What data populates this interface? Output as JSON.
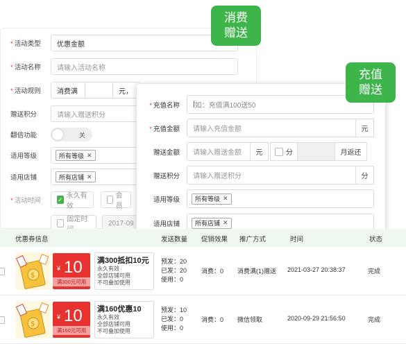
{
  "badges": {
    "consume": "消费\n赠送",
    "recharge": "充值\n赠送"
  },
  "back_form": {
    "type_label": "活动类型",
    "type_value": "优惠金额",
    "name_label": "活动名称",
    "name_placeholder": "请输入活动名称",
    "rule_label": "活动规则",
    "rule_prefix": "消费满",
    "rule_unit": "元，",
    "points_label": "赠送积分",
    "points_placeholder": "请输入赠送积分",
    "double_label": "翻倍功能",
    "double_state": "关",
    "level_label": "适用等级",
    "level_tag": "所有等级",
    "store_label": "适用店铺",
    "store_tag": "所有店铺",
    "time_label": "活动时间",
    "permanent_label": "永久有效",
    "member_label": "会员",
    "fixed_label": "固定时间",
    "fixed_date": "2017-09"
  },
  "front_form": {
    "name_label": "充值名称",
    "name_placeholder": "如：充值满100送50",
    "amount_label": "充值金额",
    "amount_placeholder": "请输入充值金额",
    "amount_unit": "元",
    "gift_label": "赠送金额",
    "gift_placeholder": "请输入赠送金额",
    "gift_unit": "元",
    "gift_fen": "分",
    "gift_monthly": "月返还",
    "points_label": "赠送积分",
    "points_placeholder": "请输入赠送积分",
    "points_unit": "分",
    "level_label": "适用等级",
    "level_tag": "所有等级",
    "store_label": "适用店铺",
    "store_tag": "所有店铺"
  },
  "table": {
    "headers": {
      "coupon": "优惠券信息",
      "sent": "发送数量",
      "effect": "促销效果",
      "method": "推广方式",
      "time": "时间",
      "status": "状态"
    },
    "rows": [
      {
        "coupon_amount": "10",
        "coupon_yen": "¥",
        "coupon_avail": "满300元可用",
        "name": "满300抵扣10元",
        "line1": "永久有效",
        "line2": "全部店铺可用",
        "line3": "不可叠加使用",
        "pre": "预发：20",
        "issued": "已发：20",
        "used": "使用：0",
        "effect": "消费：0",
        "method": "消费满(1)赠送",
        "time": "2021-03-27 20:38:37",
        "status": "完成"
      },
      {
        "coupon_amount": "10",
        "coupon_yen": "¥",
        "coupon_avail": "满160元可用",
        "name": "满160优惠10",
        "line1": "永久有效",
        "line2": "全部店铺可用",
        "line3": "不可叠加使用",
        "pre": "预发：10",
        "issued": "已发：0",
        "used": "使用：0",
        "effect": "消费：0",
        "method": "微信领取",
        "time": "2020-09-29 21:56:50",
        "status": "完成"
      }
    ]
  },
  "colors": {
    "brand_green": "#3db54a",
    "coupon_red": "#e8322f",
    "header_bg": "#eef8ee"
  }
}
